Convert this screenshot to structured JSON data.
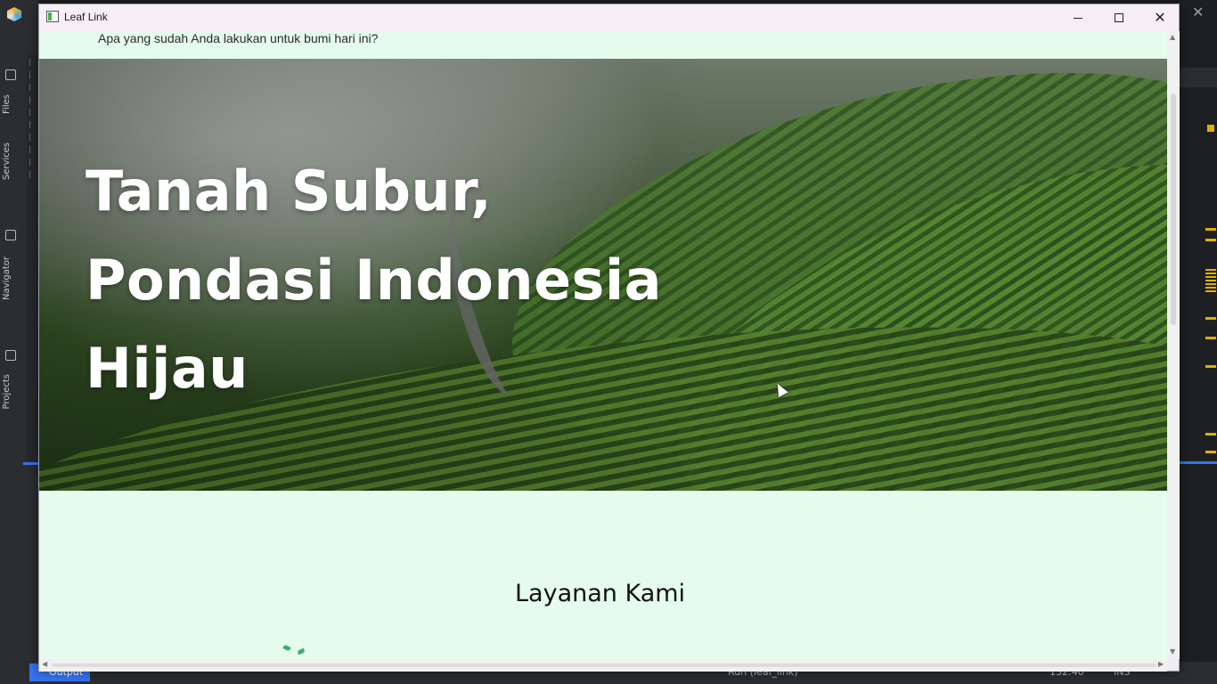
{
  "window": {
    "title": "Leaf Link",
    "minimize_icon": "minimize-icon",
    "maximize_icon": "maximize-icon",
    "close_icon": "close-icon"
  },
  "header": {
    "tagline": "Apa yang sudah Anda lakukan untuk bumi hari ini?"
  },
  "hero": {
    "line1": "Tanah Subur,",
    "line2": "Pondasi Indonesia",
    "line3": "Hijau",
    "image": "tea-plantation-hills-photo"
  },
  "services": {
    "title": "Layanan Kami"
  },
  "ide": {
    "side_tabs": [
      "Files",
      "Services",
      "Navigator",
      "Projects"
    ],
    "output_tab": "Output",
    "status_run": "Run (leaf_link)",
    "status_pos": "132:40",
    "status_mode": "INS"
  },
  "colors": {
    "page_bg": "#e5fbec",
    "headline_text": "#ffffff",
    "ide_accent": "#3574f0"
  }
}
